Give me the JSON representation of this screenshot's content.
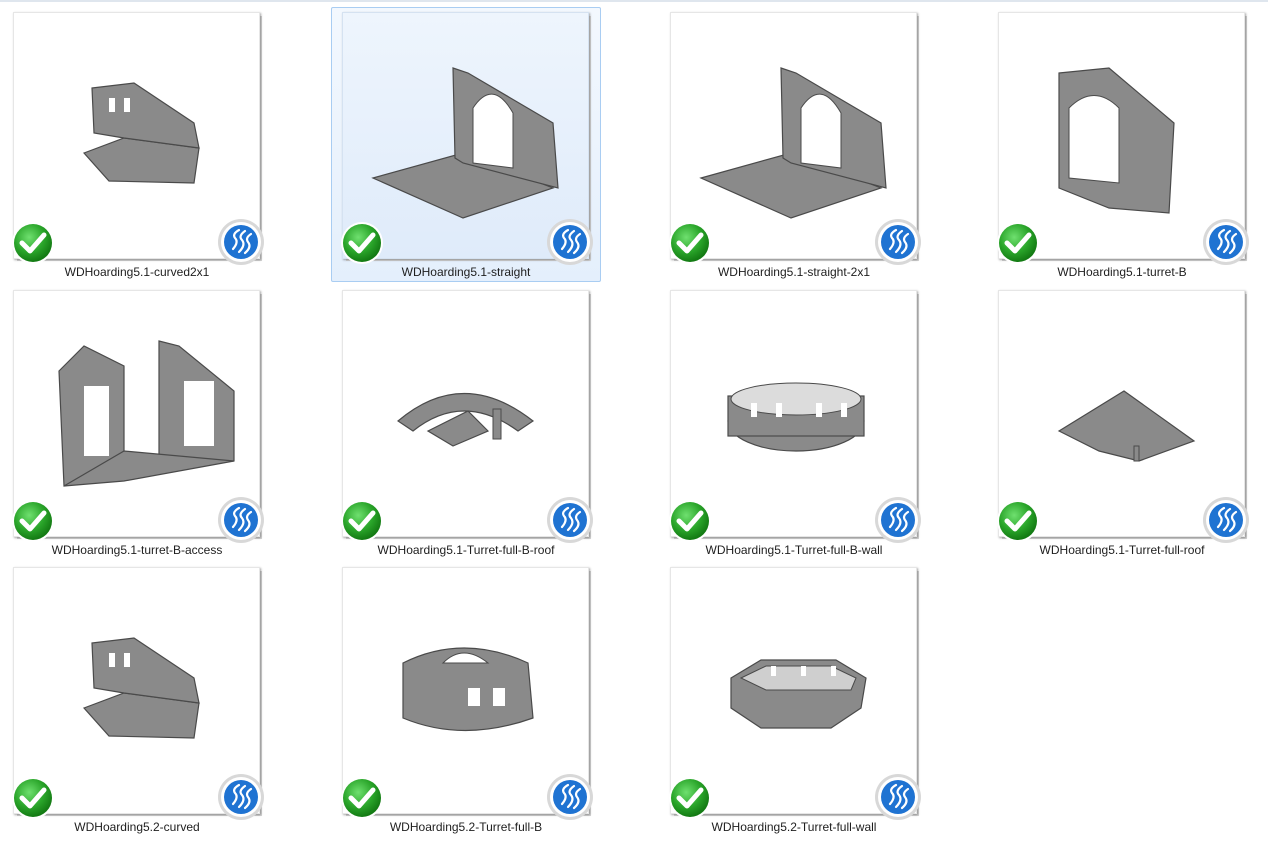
{
  "files": [
    {
      "name": "WDHoarding5.1-curved2x1",
      "selected": false,
      "model_icon": "curved-wall-model-icon",
      "status_icon": "sync-ok-check-icon",
      "app_icon": "slicer-app-icon"
    },
    {
      "name": "WDHoarding5.1-straight",
      "selected": true,
      "model_icon": "straight-wall-model-icon",
      "status_icon": "sync-ok-check-icon",
      "app_icon": "slicer-app-icon"
    },
    {
      "name": "WDHoarding5.1-straight-2x1",
      "selected": false,
      "model_icon": "straight-wall-model-icon",
      "status_icon": "sync-ok-check-icon",
      "app_icon": "slicer-app-icon"
    },
    {
      "name": "WDHoarding5.1-turret-B",
      "selected": false,
      "model_icon": "turret-model-icon",
      "status_icon": "sync-ok-check-icon",
      "app_icon": "slicer-app-icon"
    },
    {
      "name": "WDHoarding5.1-turret-B-access",
      "selected": false,
      "model_icon": "turret-access-model-icon",
      "status_icon": "sync-ok-check-icon",
      "app_icon": "slicer-app-icon"
    },
    {
      "name": "WDHoarding5.1-Turret-full-B-roof",
      "selected": false,
      "model_icon": "roof-ring-model-icon",
      "status_icon": "sync-ok-check-icon",
      "app_icon": "slicer-app-icon"
    },
    {
      "name": "WDHoarding5.1-Turret-full-B-wall",
      "selected": false,
      "model_icon": "round-wall-model-icon",
      "status_icon": "sync-ok-check-icon",
      "app_icon": "slicer-app-icon"
    },
    {
      "name": "WDHoarding5.1-Turret-full-roof",
      "selected": false,
      "model_icon": "cone-roof-model-icon",
      "status_icon": "sync-ok-check-icon",
      "app_icon": "slicer-app-icon"
    },
    {
      "name": "WDHoarding5.2-curved",
      "selected": false,
      "model_icon": "curved-wall-model-icon",
      "status_icon": "sync-ok-check-icon",
      "app_icon": "slicer-app-icon"
    },
    {
      "name": "WDHoarding5.2-Turret-full-B",
      "selected": false,
      "model_icon": "full-turret-model-icon",
      "status_icon": "sync-ok-check-icon",
      "app_icon": "slicer-app-icon"
    },
    {
      "name": "WDHoarding5.2-Turret-full-wall",
      "selected": false,
      "model_icon": "octagon-wall-model-icon",
      "status_icon": "sync-ok-check-icon",
      "app_icon": "slicer-app-icon"
    }
  ],
  "colors": {
    "model_gray": "#8a8a8a",
    "model_dark": "#4a4a4a",
    "check_green": "#2aa52a",
    "logo_blue": "#1f73d2",
    "selection_border": "#a9cdf2"
  }
}
